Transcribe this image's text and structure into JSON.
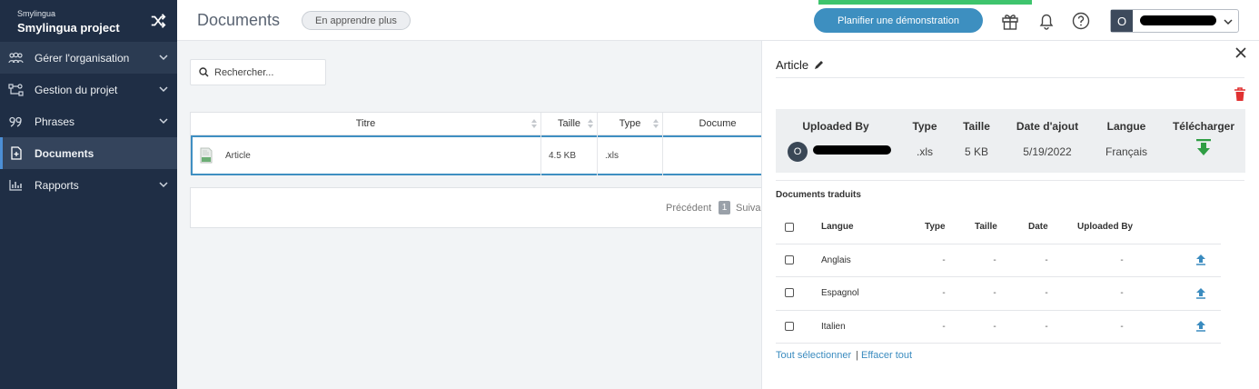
{
  "sidebar": {
    "org_name": "Smylingua",
    "project_name": "Smylingua project",
    "items": [
      {
        "label": "Gérer l'organisation",
        "icon": "people-icon"
      },
      {
        "label": "Gestion du projet",
        "icon": "project-flow-icon"
      },
      {
        "label": "Phrases",
        "icon": "quote-icon"
      },
      {
        "label": "Documents",
        "icon": "document-icon"
      },
      {
        "label": "Rapports",
        "icon": "chart-icon"
      }
    ]
  },
  "header": {
    "title": "Documents",
    "learn_more": "En apprendre plus",
    "demo_button": "Planifier une démonstration",
    "user_initial": "O"
  },
  "search": {
    "placeholder": "Rechercher..."
  },
  "documents_table": {
    "columns": [
      "Titre",
      "Taille",
      "Type",
      "Docume"
    ],
    "rows": [
      {
        "title": "Article",
        "size": "4.5 KB",
        "type": ".xls"
      }
    ]
  },
  "pagination": {
    "previous": "Précédent",
    "page": "1",
    "next": "Suivai"
  },
  "panel": {
    "title": "Article",
    "info": {
      "headers": [
        "Uploaded By",
        "Type",
        "Taille",
        "Date d'ajout",
        "Langue",
        "Télécharger"
      ],
      "uploader_initial": "O",
      "type": ".xls",
      "size": "5 KB",
      "date": "5/19/2022",
      "language": "Français"
    },
    "translated_label": "Documents traduits",
    "translated_columns": [
      "Langue",
      "Type",
      "Taille",
      "Date",
      "Uploaded By"
    ],
    "translated_rows": [
      {
        "language": "Anglais",
        "type": "-",
        "size": "-",
        "date": "-",
        "uploaded_by": "-"
      },
      {
        "language": "Espagnol",
        "type": "-",
        "size": "-",
        "date": "-",
        "uploaded_by": "-"
      },
      {
        "language": "Italien",
        "type": "-",
        "size": "-",
        "date": "-",
        "uploaded_by": "-"
      }
    ],
    "select_all": "Tout sélectionner",
    "separator": "|",
    "clear_all": "Effacer tout"
  },
  "colors": {
    "sidebar_bg": "#1f2e45",
    "accent_blue": "#3d8fc0",
    "download_green": "#2f9e44",
    "delete_red": "#e03131"
  }
}
